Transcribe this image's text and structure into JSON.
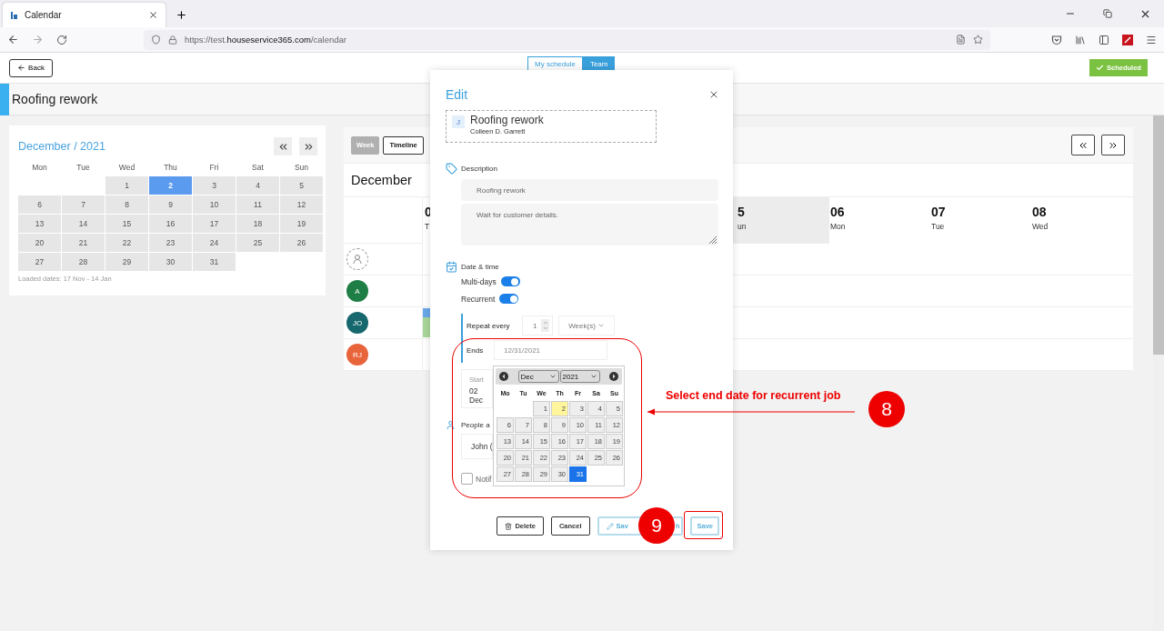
{
  "browser": {
    "tab_title": "Calendar",
    "url_prefix": "https://test.",
    "url_domain": "houseservice365.com",
    "url_path": "/calendar"
  },
  "header": {
    "back": "Back",
    "view_tabs": [
      {
        "label": "My schedule",
        "selected": false
      },
      {
        "label": "Team",
        "selected": true
      }
    ],
    "status": "Scheduled"
  },
  "job_title": "Roofing rework",
  "mini_calendar": {
    "title": "December / 2021",
    "weekdays": [
      "Mon",
      "Tue",
      "Wed",
      "Thu",
      "Fri",
      "Sat",
      "Sun"
    ],
    "weeks": [
      {
        "kind": "leading_gap",
        "days": [
          {
            "label": "1",
            "selected": false
          },
          {
            "label": "2",
            "selected": true
          },
          {
            "label": "3",
            "selected": false
          },
          {
            "label": "4",
            "selected": false
          },
          {
            "label": "5",
            "selected": false
          }
        ]
      },
      {
        "kind": "full",
        "days": [
          {
            "label": "6",
            "selected": false
          },
          {
            "label": "7",
            "selected": false
          },
          {
            "label": "8",
            "selected": false
          },
          {
            "label": "9",
            "selected": false
          },
          {
            "label": "10",
            "selected": false
          },
          {
            "label": "11",
            "selected": false
          },
          {
            "label": "12",
            "selected": false
          }
        ]
      },
      {
        "kind": "full",
        "days": [
          {
            "label": "13",
            "selected": false
          },
          {
            "label": "14",
            "selected": false
          },
          {
            "label": "15",
            "selected": false
          },
          {
            "label": "16",
            "selected": false
          },
          {
            "label": "17",
            "selected": false
          },
          {
            "label": "18",
            "selected": false
          },
          {
            "label": "19",
            "selected": false
          }
        ]
      },
      {
        "kind": "full",
        "days": [
          {
            "label": "20",
            "selected": false
          },
          {
            "label": "21",
            "selected": false
          },
          {
            "label": "22",
            "selected": false
          },
          {
            "label": "23",
            "selected": false
          },
          {
            "label": "24",
            "selected": false
          },
          {
            "label": "25",
            "selected": false
          },
          {
            "label": "26",
            "selected": false
          }
        ]
      },
      {
        "kind": "trailing_gap",
        "days": [
          {
            "label": "27",
            "selected": false
          },
          {
            "label": "28",
            "selected": false
          },
          {
            "label": "29",
            "selected": false
          },
          {
            "label": "30",
            "selected": false
          },
          {
            "label": "31",
            "selected": false
          }
        ]
      }
    ],
    "loaded_dates": "Loaded dates: 17 Nov - 14 Jan"
  },
  "week_view": {
    "modes": [
      {
        "label": "Week",
        "selected": true
      },
      {
        "label": "Timeline",
        "selected": false
      }
    ],
    "month": "December",
    "days": [
      {
        "number": "0",
        "name": "T",
        "shaded": false
      },
      {
        "number": "5",
        "name": "un",
        "shaded": true
      },
      {
        "number": "06",
        "name": "Mon",
        "shaded": false
      },
      {
        "number": "07",
        "name": "Tue",
        "shaded": false
      },
      {
        "number": "08",
        "name": "Wed",
        "shaded": false
      }
    ],
    "resources": [
      {
        "kind": "unassigned",
        "has_event": false
      },
      {
        "kind": "person",
        "initials": "A",
        "color": "#1e7e45",
        "has_event": false
      },
      {
        "kind": "person",
        "initials": "JO",
        "color": "#17686e",
        "has_event": true
      },
      {
        "kind": "person",
        "initials": "RJ",
        "color": "#e8643a",
        "has_event": false
      }
    ]
  },
  "modal": {
    "title": "Edit",
    "job": {
      "badge": "J",
      "title": "Roofing rework",
      "customer": "Colleen D. Garrett"
    },
    "description": {
      "label": "Description",
      "summary": "Roofing rework",
      "notes": "Wait for customer details."
    },
    "date_time": {
      "label": "Date & time",
      "toggles": [
        {
          "label": "Multi-days",
          "on": true
        },
        {
          "label": "Recurrent",
          "on": true
        }
      ],
      "repeat_label": "Repeat every",
      "repeat_value": "1",
      "repeat_unit": "Week(s)",
      "ends_label": "Ends",
      "ends_value": "12/31/2021",
      "start_label": "Start",
      "start_value": "02 Dec"
    },
    "people": {
      "label": "People a",
      "value": "John ("
    },
    "notify": {
      "label": "Notif",
      "checked": false
    },
    "buttons": [
      {
        "kind": "delete",
        "label": "Delete"
      },
      {
        "kind": "cancel",
        "label": "Cancel"
      },
      {
        "kind": "split",
        "label_start": "Sav",
        "label_end": "h"
      },
      {
        "kind": "save",
        "label": "Save"
      }
    ]
  },
  "datepicker": {
    "month": "Dec",
    "year": "2021",
    "weekdays": [
      "Mo",
      "Tu",
      "We",
      "Th",
      "Fr",
      "Sa",
      "Su"
    ],
    "weeks": [
      {
        "kind": "leading_gap",
        "days": [
          {
            "label": "1",
            "today": false,
            "selected": false
          },
          {
            "label": "2",
            "today": true,
            "selected": false
          },
          {
            "label": "3",
            "today": false,
            "selected": false
          },
          {
            "label": "4",
            "today": false,
            "selected": false
          },
          {
            "label": "5",
            "today": false,
            "selected": false
          }
        ]
      },
      {
        "kind": "full",
        "days": [
          {
            "label": "6",
            "today": false,
            "selected": false
          },
          {
            "label": "7",
            "today": false,
            "selected": false
          },
          {
            "label": "8",
            "today": false,
            "selected": false
          },
          {
            "label": "9",
            "today": false,
            "selected": false
          },
          {
            "label": "10",
            "today": false,
            "selected": false
          },
          {
            "label": "11",
            "today": false,
            "selected": false
          },
          {
            "label": "12",
            "today": false,
            "selected": false
          }
        ]
      },
      {
        "kind": "full",
        "days": [
          {
            "label": "13",
            "today": false,
            "selected": false
          },
          {
            "label": "14",
            "today": false,
            "selected": false
          },
          {
            "label": "15",
            "today": false,
            "selected": false
          },
          {
            "label": "16",
            "today": false,
            "selected": false
          },
          {
            "label": "17",
            "today": false,
            "selected": false
          },
          {
            "label": "18",
            "today": false,
            "selected": false
          },
          {
            "label": "19",
            "today": false,
            "selected": false
          }
        ]
      },
      {
        "kind": "full",
        "days": [
          {
            "label": "20",
            "today": false,
            "selected": false
          },
          {
            "label": "21",
            "today": false,
            "selected": false
          },
          {
            "label": "22",
            "today": false,
            "selected": false
          },
          {
            "label": "23",
            "today": false,
            "selected": false
          },
          {
            "label": "24",
            "today": false,
            "selected": false
          },
          {
            "label": "25",
            "today": false,
            "selected": false
          },
          {
            "label": "26",
            "today": false,
            "selected": false
          }
        ]
      },
      {
        "kind": "trailing_gap",
        "days": [
          {
            "label": "27",
            "today": false,
            "selected": false
          },
          {
            "label": "28",
            "today": false,
            "selected": false
          },
          {
            "label": "29",
            "today": false,
            "selected": false
          },
          {
            "label": "30",
            "today": false,
            "selected": false
          },
          {
            "label": "31",
            "today": false,
            "selected": true
          }
        ]
      }
    ]
  },
  "annotations": [
    {
      "kind": "arrow",
      "number": "8",
      "text": "Select end date for recurrent job"
    },
    {
      "kind": "highlight",
      "number": "9"
    }
  ]
}
